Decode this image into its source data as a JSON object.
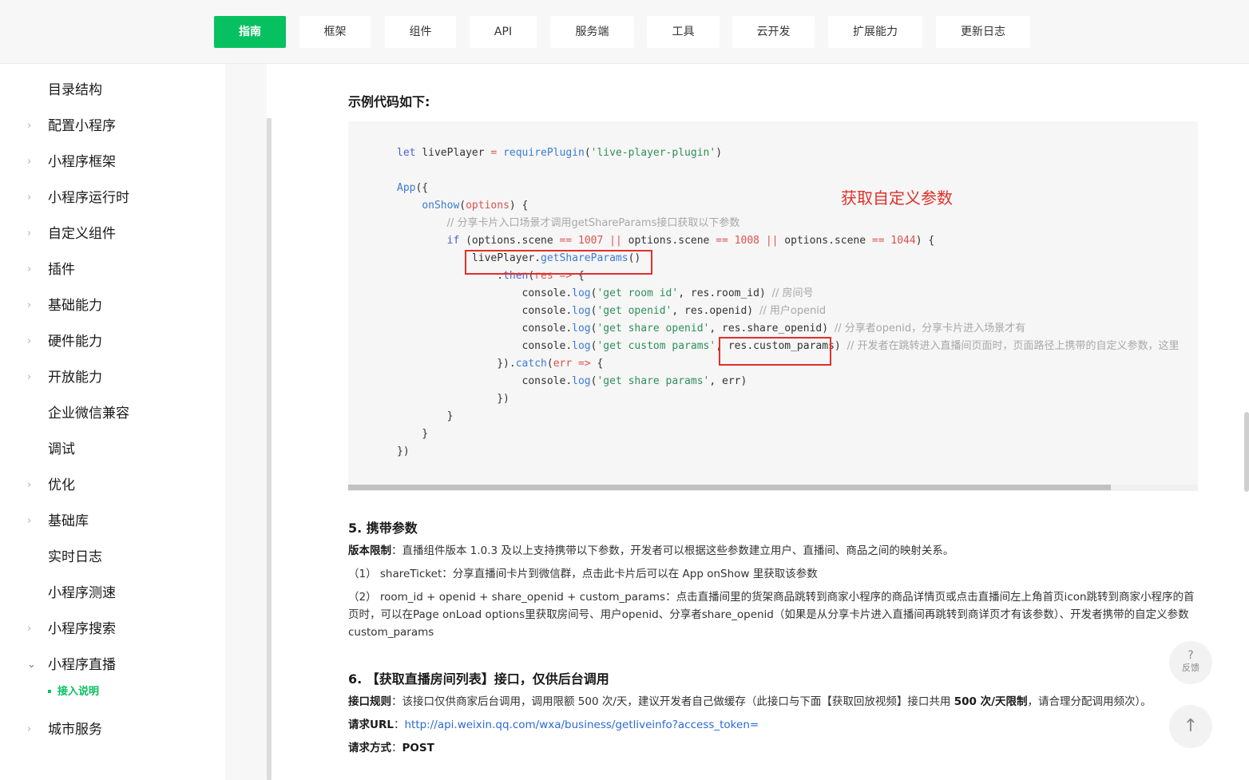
{
  "nav": {
    "tabs": [
      {
        "label": "指南",
        "active": true
      },
      {
        "label": "框架"
      },
      {
        "label": "组件"
      },
      {
        "label": "API"
      },
      {
        "label": "服务端"
      },
      {
        "label": "工具"
      },
      {
        "label": "云开发"
      },
      {
        "label": "扩展能力"
      },
      {
        "label": "更新日志"
      }
    ]
  },
  "sidebar": {
    "items": [
      {
        "label": "目录结构",
        "chevron": false
      },
      {
        "label": "配置小程序",
        "chevron": true
      },
      {
        "label": "小程序框架",
        "chevron": true
      },
      {
        "label": "小程序运行时",
        "chevron": true
      },
      {
        "label": "自定义组件",
        "chevron": true
      },
      {
        "label": "插件",
        "chevron": true
      },
      {
        "label": "基础能力",
        "chevron": true
      },
      {
        "label": "硬件能力",
        "chevron": true
      },
      {
        "label": "开放能力",
        "chevron": true
      },
      {
        "label": "企业微信兼容",
        "chevron": false
      },
      {
        "label": "调试",
        "chevron": false
      },
      {
        "label": "优化",
        "chevron": true
      },
      {
        "label": "基础库",
        "chevron": true
      },
      {
        "label": "实时日志",
        "chevron": false
      },
      {
        "label": "小程序测速",
        "chevron": false
      },
      {
        "label": "小程序搜索",
        "chevron": true
      },
      {
        "label": "小程序直播",
        "chevron": true,
        "open": true
      },
      {
        "label": "城市服务",
        "chevron": true
      }
    ],
    "active_sub": "接入说明"
  },
  "content": {
    "example_heading": "示例代码如下:",
    "annotation": "获取自定义参数",
    "section5_title": "5. 携带参数",
    "s5_p1_label": "版本限制",
    "s5_p1_text": "：直播组件版本 1.0.3 及以上支持携带以下参数，开发者可以根据这些参数建立用户、直播间、商品之间的映射关系。",
    "s5_p2": "（1） shareTicket：分享直播间卡片到微信群，点击此卡片后可以在 App onShow 里获取该参数",
    "s5_p3": "（2） room_id + openid + share_openid + custom_params：点击直播间里的货架商品跳转到商家小程序的商品详情页或点击直播间左上角首页icon跳转到商家小程序的首页时，可以在Page onLoad options里获取房间号、用户openid、分享者share_openid（如果是从分享卡片进入直播间再跳转到商详页才有该参数）、开发者携带的自定义参数custom_params",
    "section6_title": "6. 【获取直播房间列表】接口，仅供后台调用",
    "s6_rule_label": "接口规则",
    "s6_rule_text": "：该接口仅供商家后台调用，调用限额 500 次/天，建议开发者自己做缓存（此接口与下面【获取回放视频】接口共用 ",
    "s6_rule_bold": "500 次/天限制",
    "s6_rule_tail": "，请合理分配调用频次）。",
    "s6_url_label": "请求URL",
    "s6_url": "http://api.weixin.qq.com/wxa/business/getliveinfo?access_token=",
    "s6_method_label": "请求方式",
    "s6_method": "POST"
  },
  "floating": {
    "feedback_q": "?",
    "feedback_label": "反馈",
    "top_icon": "↑"
  },
  "colors": {
    "accent": "#07c160",
    "annotation": "#e0302a",
    "link": "#2a6ad6"
  }
}
